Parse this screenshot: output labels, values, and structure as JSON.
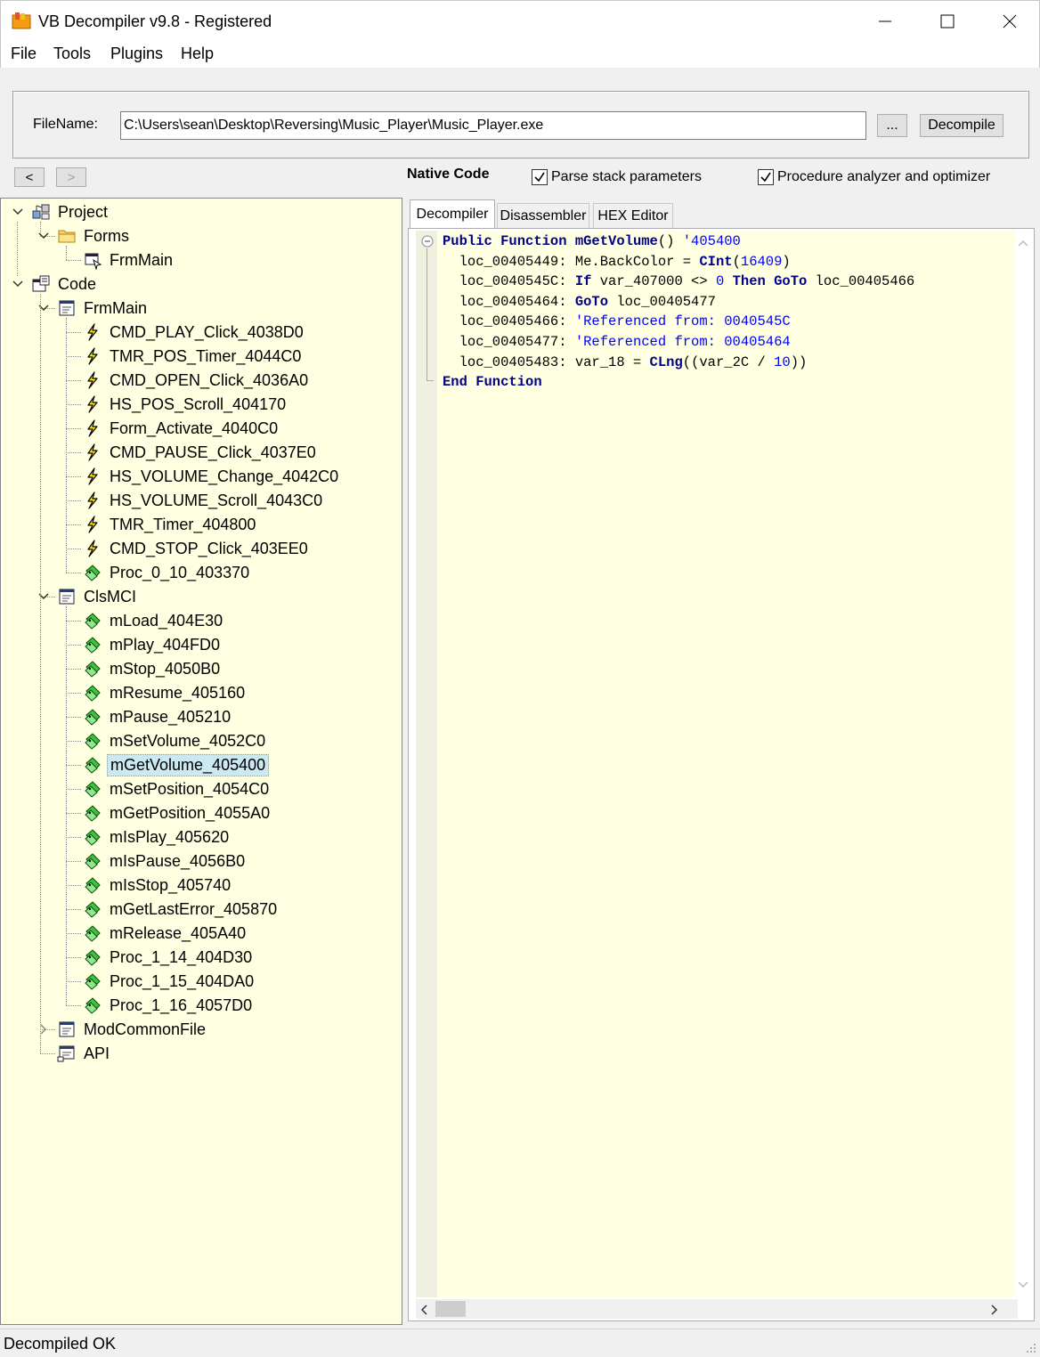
{
  "window": {
    "title": "VB Decompiler v9.8 - Registered"
  },
  "menu": [
    "File",
    "Tools",
    "Plugins",
    "Help"
  ],
  "file_panel": {
    "label": "FileName:",
    "value": "C:\\Users\\sean\\Desktop\\Reversing\\Music_Player\\Music_Player.exe",
    "browse_label": "...",
    "decompile_label": "Decompile"
  },
  "options": {
    "back_label": "<",
    "forward_label": ">",
    "native_code_label": "Native Code",
    "parse_stack_label": "Parse stack parameters",
    "parse_stack_checked": true,
    "procedure_analyzer_label": "Procedure analyzer and optimizer",
    "procedure_analyzer_checked": true
  },
  "tree": [
    {
      "label": "Project",
      "level": 0,
      "icon": "project-icon",
      "expanded": true
    },
    {
      "label": "Forms",
      "level": 1,
      "icon": "folder-icon",
      "expanded": true
    },
    {
      "label": "FrmMain",
      "level": 2,
      "icon": "form-icon"
    },
    {
      "label": "Code",
      "level": 0,
      "icon": "code-icon",
      "expanded": true
    },
    {
      "label": "FrmMain",
      "level": 1,
      "icon": "module-icon",
      "expanded": true
    },
    {
      "label": "CMD_PLAY_Click_4038D0",
      "level": 2,
      "icon": "event-icon"
    },
    {
      "label": "TMR_POS_Timer_4044C0",
      "level": 2,
      "icon": "event-icon"
    },
    {
      "label": "CMD_OPEN_Click_4036A0",
      "level": 2,
      "icon": "event-icon"
    },
    {
      "label": "HS_POS_Scroll_404170",
      "level": 2,
      "icon": "event-icon"
    },
    {
      "label": "Form_Activate_4040C0",
      "level": 2,
      "icon": "event-icon"
    },
    {
      "label": "CMD_PAUSE_Click_4037E0",
      "level": 2,
      "icon": "event-icon"
    },
    {
      "label": "HS_VOLUME_Change_4042C0",
      "level": 2,
      "icon": "event-icon"
    },
    {
      "label": "HS_VOLUME_Scroll_4043C0",
      "level": 2,
      "icon": "event-icon"
    },
    {
      "label": "TMR_Timer_404800",
      "level": 2,
      "icon": "event-icon"
    },
    {
      "label": "CMD_STOP_Click_403EE0",
      "level": 2,
      "icon": "event-icon"
    },
    {
      "label": "Proc_0_10_403370",
      "level": 2,
      "icon": "procedure-icon"
    },
    {
      "label": "ClsMCI",
      "level": 1,
      "icon": "module-icon",
      "expanded": true
    },
    {
      "label": "mLoad_404E30",
      "level": 2,
      "icon": "procedure-icon"
    },
    {
      "label": "mPlay_404FD0",
      "level": 2,
      "icon": "procedure-icon"
    },
    {
      "label": "mStop_4050B0",
      "level": 2,
      "icon": "procedure-icon"
    },
    {
      "label": "mResume_405160",
      "level": 2,
      "icon": "procedure-icon"
    },
    {
      "label": "mPause_405210",
      "level": 2,
      "icon": "procedure-icon"
    },
    {
      "label": "mSetVolume_4052C0",
      "level": 2,
      "icon": "procedure-icon"
    },
    {
      "label": "mGetVolume_405400",
      "level": 2,
      "icon": "procedure-icon",
      "selected": true
    },
    {
      "label": "mSetPosition_4054C0",
      "level": 2,
      "icon": "procedure-icon"
    },
    {
      "label": "mGetPosition_4055A0",
      "level": 2,
      "icon": "procedure-icon"
    },
    {
      "label": "mIsPlay_405620",
      "level": 2,
      "icon": "procedure-icon"
    },
    {
      "label": "mIsPause_4056B0",
      "level": 2,
      "icon": "procedure-icon"
    },
    {
      "label": "mIsStop_405740",
      "level": 2,
      "icon": "procedure-icon"
    },
    {
      "label": "mGetLastError_405870",
      "level": 2,
      "icon": "procedure-icon"
    },
    {
      "label": "mRelease_405A40",
      "level": 2,
      "icon": "procedure-icon"
    },
    {
      "label": "Proc_1_14_404D30",
      "level": 2,
      "icon": "procedure-icon"
    },
    {
      "label": "Proc_1_15_404DA0",
      "level": 2,
      "icon": "procedure-icon"
    },
    {
      "label": "Proc_1_16_4057D0",
      "level": 2,
      "icon": "procedure-icon"
    },
    {
      "label": "ModCommonFile",
      "level": 1,
      "icon": "module-icon",
      "expanded": false
    },
    {
      "label": "API",
      "level": 1,
      "icon": "api-icon"
    }
  ],
  "tabs": [
    "Decompiler",
    "Disassembler",
    "HEX Editor"
  ],
  "active_tab": "Decompiler",
  "code": [
    [
      [
        "kw",
        "Public Function "
      ],
      [
        "fn",
        "mGetVolume"
      ],
      [
        "t",
        "() "
      ],
      [
        "cm",
        "'405400"
      ]
    ],
    [
      [
        "t",
        "  loc_00405449: Me.BackColor = "
      ],
      [
        "kw",
        "CInt"
      ],
      [
        "t",
        "("
      ],
      [
        "num",
        "16409"
      ],
      [
        "t",
        ")"
      ]
    ],
    [
      [
        "t",
        "  loc_0040545C: "
      ],
      [
        "kw",
        "If"
      ],
      [
        "t",
        " var_407000 <> "
      ],
      [
        "num",
        "0"
      ],
      [
        "t",
        " "
      ],
      [
        "kw",
        "Then GoTo"
      ],
      [
        "t",
        " loc_00405466"
      ]
    ],
    [
      [
        "t",
        "  loc_00405464: "
      ],
      [
        "kw",
        "GoTo"
      ],
      [
        "t",
        " loc_00405477"
      ]
    ],
    [
      [
        "t",
        "  loc_00405466: "
      ],
      [
        "cm",
        "'Referenced from: 0040545C"
      ]
    ],
    [
      [
        "t",
        "  loc_00405477: "
      ],
      [
        "cm",
        "'Referenced from: 00405464"
      ]
    ],
    [
      [
        "t",
        "  loc_00405483: var_18 = "
      ],
      [
        "kw",
        "CLng"
      ],
      [
        "t",
        "((var_2C / "
      ],
      [
        "num",
        "10"
      ],
      [
        "t",
        "))"
      ]
    ],
    [
      [
        "kw",
        "End Function"
      ]
    ]
  ],
  "status": "Decompiled OK",
  "colors": {
    "tree_bg": "#ffffe1",
    "code_bg": "#ffffe1",
    "keyword": "#00008b",
    "literal": "#0000ff",
    "selection": "#cce8f0"
  }
}
